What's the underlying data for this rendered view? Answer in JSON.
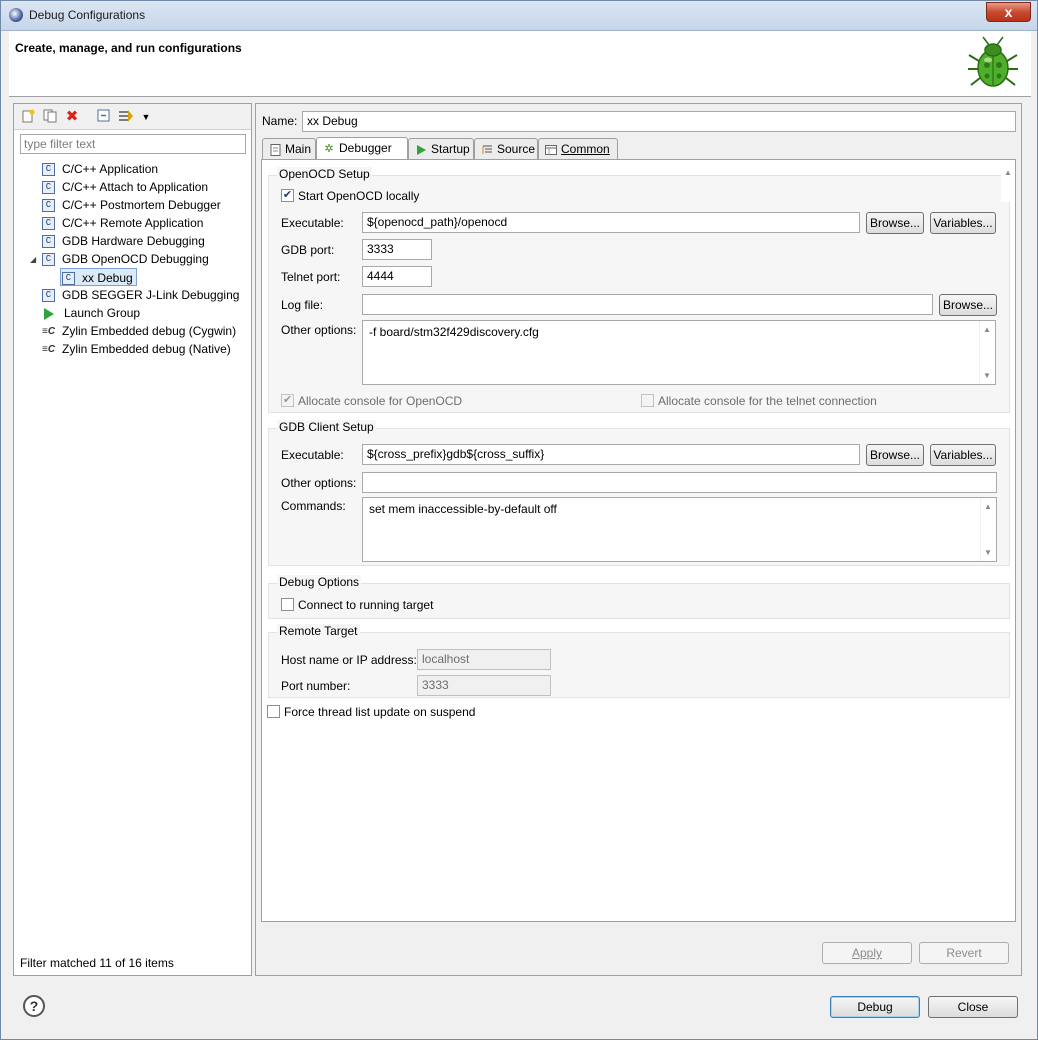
{
  "window": {
    "title": "Debug Configurations",
    "close_label": "x"
  },
  "banner": {
    "heading": "Create, manage, and run configurations"
  },
  "left_pane": {
    "filter_placeholder": "type filter text",
    "tree": [
      {
        "label": "C/C++ Application",
        "icon": "c-config-icon"
      },
      {
        "label": "C/C++ Attach to Application",
        "icon": "c-config-icon"
      },
      {
        "label": "C/C++ Postmortem Debugger",
        "icon": "c-config-icon"
      },
      {
        "label": "C/C++ Remote Application",
        "icon": "c-config-icon"
      },
      {
        "label": "GDB Hardware Debugging",
        "icon": "c-config-icon"
      },
      {
        "label": "GDB OpenOCD Debugging",
        "icon": "c-config-icon",
        "expanded": true
      },
      {
        "label": "xx Debug",
        "icon": "c-config-icon",
        "selected": true,
        "child": true
      },
      {
        "label": "GDB SEGGER J-Link Debugging",
        "icon": "c-config-icon"
      },
      {
        "label": "Launch Group",
        "icon": "launch-group-icon"
      },
      {
        "label": "Zylin Embedded debug (Cygwin)",
        "icon": "zylin-icon"
      },
      {
        "label": "Zylin Embedded debug (Native)",
        "icon": "zylin-icon"
      }
    ],
    "filter_status": "Filter matched 11 of 16 items"
  },
  "right_pane": {
    "name_label": "Name:",
    "name_value": "xx Debug",
    "tabs": [
      {
        "label": "Main",
        "icon": "main-tab-icon"
      },
      {
        "label": "Debugger",
        "icon": "debugger-tab-icon",
        "active": true
      },
      {
        "label": "Startup",
        "icon": "startup-tab-icon"
      },
      {
        "label": "Source",
        "icon": "source-tab-icon"
      },
      {
        "label": "Common",
        "icon": "common-tab-icon"
      }
    ],
    "openocd": {
      "title": "OpenOCD Setup",
      "start_locally_label": "Start OpenOCD locally",
      "executable_label": "Executable:",
      "executable_value": "${openocd_path}/openocd",
      "gdb_port_label": "GDB port:",
      "gdb_port_value": "3333",
      "telnet_port_label": "Telnet port:",
      "telnet_port_value": "4444",
      "log_file_label": "Log file:",
      "log_file_value": "",
      "other_options_label": "Other options:",
      "other_options_value": "-f board/stm32f429discovery.cfg",
      "allocate_console_label": "Allocate console for OpenOCD",
      "allocate_telnet_label": "Allocate console for the telnet connection"
    },
    "gdb_client": {
      "title": "GDB Client Setup",
      "executable_label": "Executable:",
      "executable_value": "${cross_prefix}gdb${cross_suffix}",
      "other_options_label": "Other options:",
      "other_options_value": "",
      "commands_label": "Commands:",
      "commands_value": "set mem inaccessible-by-default off"
    },
    "debug_options": {
      "title": "Debug Options",
      "connect_running_label": "Connect to running target"
    },
    "remote_target": {
      "title": "Remote Target",
      "host_label": "Host name or IP address:",
      "host_value": "localhost",
      "port_label": "Port number:",
      "port_value": "3333"
    },
    "force_thread_label": "Force thread list update on suspend",
    "browse_label": "Browse...",
    "variables_label": "Variables...",
    "apply_label": "Apply",
    "revert_label": "Revert"
  },
  "footer": {
    "help_label": "?",
    "debug_label": "Debug",
    "close_label": "Close"
  }
}
